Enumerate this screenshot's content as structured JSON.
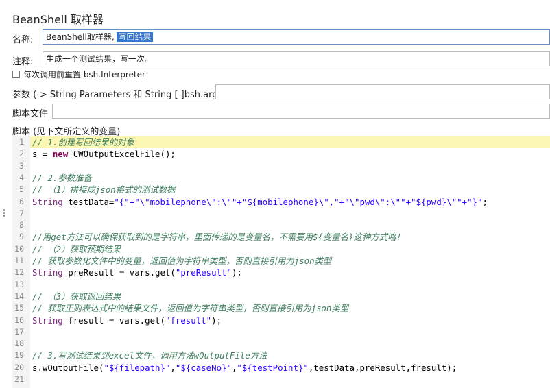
{
  "panel": {
    "title": "BeanShell 取样器",
    "name_label": "名称:",
    "name_value_plain": "BeanShell取样器, ",
    "name_value_selected": "写回结果",
    "comment_label": "注释:",
    "comment_value": "生成一个测试结果，写一次。",
    "reset_checkbox_label": "每次调用前重置 bsh.Interpreter",
    "params_label": "参数 (-> String Parameters 和 String [ ]bsh.args)",
    "params_value": "",
    "script_file_label": "脚本文件",
    "script_file_value": "",
    "script_label": "脚本 (见下文所定义的变量)"
  },
  "editor": {
    "highlight_line": 1,
    "lines": [
      {
        "n": "1",
        "segs": [
          {
            "t": "// 1.创建写回结果的对象",
            "c": "cm"
          }
        ]
      },
      {
        "n": "2",
        "segs": [
          {
            "t": "s = ",
            "c": ""
          },
          {
            "t": "new",
            "c": "kw"
          },
          {
            "t": " CWOutputExcelFile();",
            "c": ""
          }
        ]
      },
      {
        "n": "3",
        "segs": []
      },
      {
        "n": "4",
        "segs": [
          {
            "t": "// 2.参数准备",
            "c": "cm"
          }
        ]
      },
      {
        "n": "5",
        "segs": [
          {
            "t": "// （1）拼接成json格式的测试数据",
            "c": "cm"
          }
        ]
      },
      {
        "n": "6",
        "segs": [
          {
            "t": "String",
            "c": "ty"
          },
          {
            "t": " testData=",
            "c": ""
          },
          {
            "t": "\"{\"+\"\\\"mobilephone\\\":\\\"\"+\"${mobilephone}\\\",\"+\"\\\"pwd\\\":\\\"\"+\"${pwd}\\\"\"+\"}\"",
            "c": "str"
          },
          {
            "t": ";",
            "c": ""
          }
        ]
      },
      {
        "n": "7",
        "segs": []
      },
      {
        "n": "8",
        "segs": []
      },
      {
        "n": "9",
        "segs": [
          {
            "t": "//用get方法可以确保获取到的是字符串，里面传递的是变量名，不需要用${变量名}这种方式咯！",
            "c": "cm"
          }
        ]
      },
      {
        "n": "10",
        "segs": [
          {
            "t": "// （2）获取预期结果",
            "c": "cm"
          }
        ]
      },
      {
        "n": "11",
        "segs": [
          {
            "t": "// 获取参数化文件中的变量，返回值为字符串类型，否则直接引用为json类型",
            "c": "cm"
          }
        ]
      },
      {
        "n": "12",
        "segs": [
          {
            "t": "String",
            "c": "ty"
          },
          {
            "t": " preResult = vars.get(",
            "c": ""
          },
          {
            "t": "\"preResult\"",
            "c": "str"
          },
          {
            "t": ");",
            "c": ""
          }
        ]
      },
      {
        "n": "13",
        "segs": []
      },
      {
        "n": "14",
        "segs": [
          {
            "t": "// （3）获取返回结果",
            "c": "cm"
          }
        ]
      },
      {
        "n": "15",
        "segs": [
          {
            "t": "// 获取正则表达式中的结果文件，返回值为字符串类型，否则直接引用为json类型",
            "c": "cm"
          }
        ]
      },
      {
        "n": "16",
        "segs": [
          {
            "t": "String",
            "c": "ty"
          },
          {
            "t": " fresult = vars.get(",
            "c": ""
          },
          {
            "t": "\"fresult\"",
            "c": "str"
          },
          {
            "t": ");",
            "c": ""
          }
        ]
      },
      {
        "n": "17",
        "segs": []
      },
      {
        "n": "18",
        "segs": []
      },
      {
        "n": "19",
        "segs": [
          {
            "t": "// 3.写测试结果到excel文件，调用方法wOutputFile方法",
            "c": "cm"
          }
        ]
      },
      {
        "n": "20",
        "segs": [
          {
            "t": "s.wOutputFile(",
            "c": ""
          },
          {
            "t": "\"${filepath}\"",
            "c": "str"
          },
          {
            "t": ",",
            "c": ""
          },
          {
            "t": "\"${caseNo}\"",
            "c": "str"
          },
          {
            "t": ",",
            "c": ""
          },
          {
            "t": "\"${testPoint}\"",
            "c": "str"
          },
          {
            "t": ",testData,preResult,fresult);",
            "c": ""
          }
        ]
      },
      {
        "n": "21",
        "segs": []
      }
    ]
  }
}
